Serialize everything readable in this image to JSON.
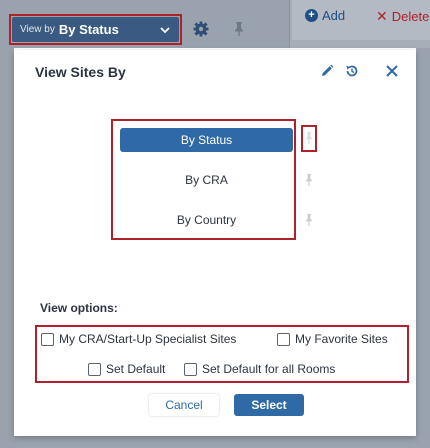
{
  "toolbar": {
    "viewby_prefix": "View by",
    "viewby_value": "By Status",
    "add_label": "Add",
    "delete_label": "Delete"
  },
  "dialog": {
    "title": "View Sites By",
    "list_items": [
      "By Status",
      "By CRA",
      "By Country"
    ],
    "selected_index": 0,
    "view_options_label": "View options:",
    "options": {
      "my_cra_sites": "My CRA/Start-Up Specialist Sites",
      "my_favorite_sites": "My Favorite Sites",
      "set_default": "Set Default",
      "set_default_all_rooms": "Set Default for all Rooms"
    },
    "cancel_label": "Cancel",
    "select_label": "Select"
  },
  "colors": {
    "primary": "#2f6aa6",
    "highlight_outline": "#b0222a",
    "delete_red": "#b0222a",
    "viewby_button": "#3a5a82"
  },
  "icons": {
    "toolbar": [
      "chevron-down-icon",
      "gear-icon",
      "pin-icon",
      "add-circle-icon",
      "close-icon"
    ],
    "dialog": [
      "pencil-icon",
      "reset-icon",
      "close-icon",
      "pin-icon"
    ]
  }
}
